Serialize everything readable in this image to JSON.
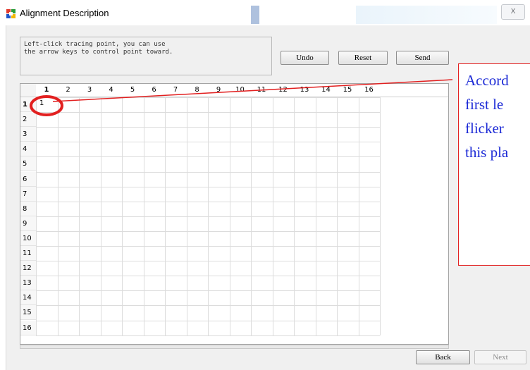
{
  "window": {
    "title": "Alignment Description",
    "close_glyph": "X",
    "icon": "app-color-grid-icon"
  },
  "instructions": {
    "lines": [
      "Left-click tracing point, you can use",
      "the arrow keys to control point toward."
    ]
  },
  "toolbar": {
    "undo_label": "Undo",
    "reset_label": "Reset",
    "send_label": "Send"
  },
  "grid": {
    "columns": [
      "1",
      "2",
      "3",
      "4",
      "5",
      "6",
      "7",
      "8",
      "9",
      "10",
      "11",
      "12",
      "13",
      "14",
      "15",
      "16"
    ],
    "rows": [
      "1",
      "2",
      "3",
      "4",
      "5",
      "6",
      "7",
      "8",
      "9",
      "10",
      "11",
      "12",
      "13",
      "14",
      "15",
      "16"
    ],
    "selected_row": "1",
    "selected_col": "1",
    "cell_value": "1"
  },
  "annotation": {
    "lines": [
      "Accord",
      "first le",
      "flicker",
      "this pla"
    ],
    "color": "#e22020",
    "text_color": "#1d2bd6"
  },
  "footer": {
    "back_label": "Back",
    "next_label": "Next"
  }
}
